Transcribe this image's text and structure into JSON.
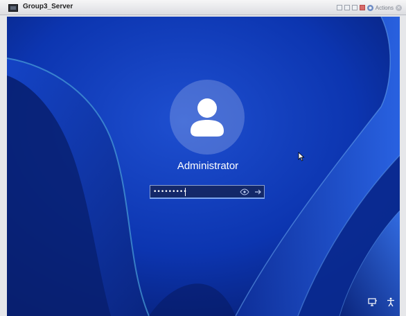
{
  "window": {
    "title": "Group3_Server",
    "actions_label": "Actions"
  },
  "lockscreen": {
    "username": "Administrator",
    "password_value": "•••••••••",
    "icons": {
      "avatar": "user-avatar-icon",
      "reveal": "eye-icon",
      "submit": "arrow-right-icon",
      "network": "network-icon",
      "accessibility": "accessibility-icon",
      "cursor": "mouse-pointer-icon"
    }
  },
  "colors": {
    "background": "#0a2a8a",
    "accent": "#7fa6ee"
  }
}
